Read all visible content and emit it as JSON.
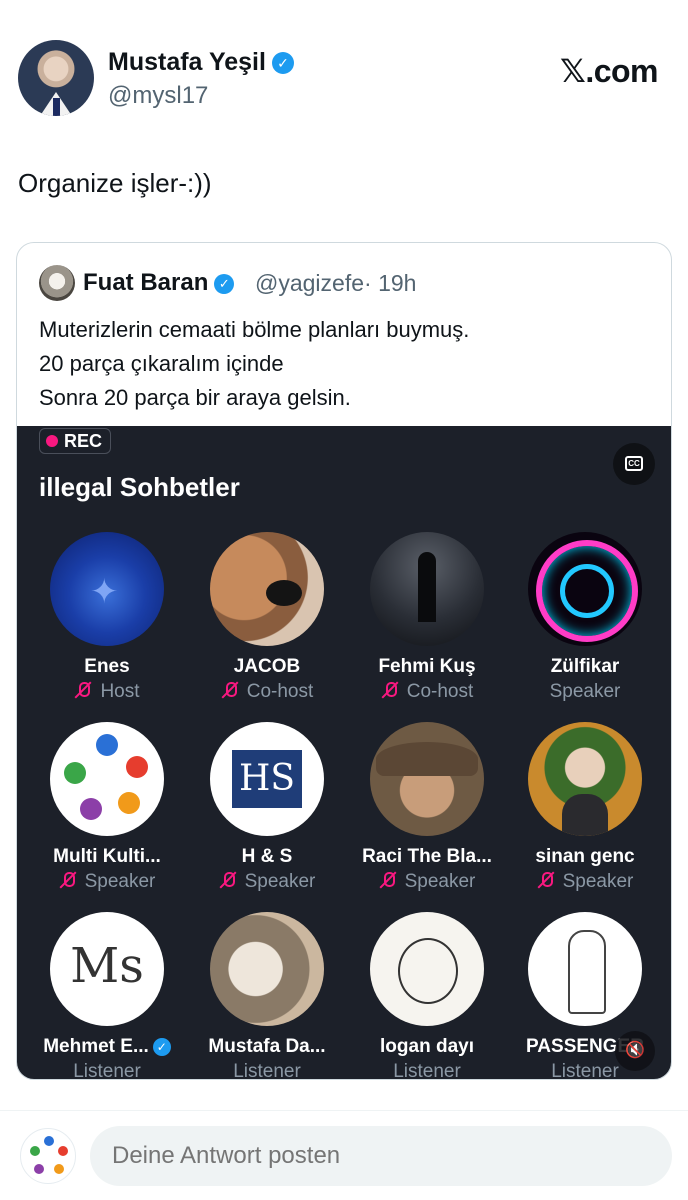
{
  "post": {
    "author_name": "Mustafa Yeşil",
    "author_handle": "@mysl17",
    "site": "𝕏.com",
    "text": "Organize işler-:))"
  },
  "quoted": {
    "author_name": "Fuat Baran",
    "author_handle": "@yagizefe",
    "time": "· 19h",
    "lines": [
      "Muterizlerin cemaati bölme planları buymuş.",
      "20 parça çıkaralım içinde",
      "Sonra 20 parça bir araya gelsin."
    ],
    "space": {
      "rec_label": "REC",
      "cc_label": "CC",
      "title": "illegal Sohbetler",
      "participants": [
        {
          "name": "Enes",
          "role": "Host",
          "muted": true
        },
        {
          "name": "JACOB",
          "role": "Co-host",
          "muted": true
        },
        {
          "name": "Fehmi Kuş",
          "role": "Co-host",
          "muted": true
        },
        {
          "name": "Zülfikar",
          "role": "Speaker",
          "muted": false
        },
        {
          "name": "Multi Kulti...",
          "role": "Speaker",
          "muted": true
        },
        {
          "name": "H & S",
          "role": "Speaker",
          "muted": true
        },
        {
          "name": "Raci The Bla...",
          "role": "Speaker",
          "muted": true
        },
        {
          "name": "sinan genc",
          "role": "Speaker",
          "muted": true
        },
        {
          "name": "Mehmet E...",
          "role": "Listener",
          "muted": false,
          "verified": true
        },
        {
          "name": "Mustafa Da...",
          "role": "Listener",
          "muted": false
        },
        {
          "name": "logan dayı",
          "role": "Listener",
          "muted": false
        },
        {
          "name": "PASSENGER",
          "role": "Listener",
          "muted": false
        }
      ],
      "hs_logo": "HS",
      "ms_logo": "Ms"
    }
  },
  "reply": {
    "placeholder": "Deine Antwort posten"
  },
  "colors": {
    "accent": "#1d9bf0",
    "mute": "#f91880",
    "space_bg": "#1c2029"
  }
}
